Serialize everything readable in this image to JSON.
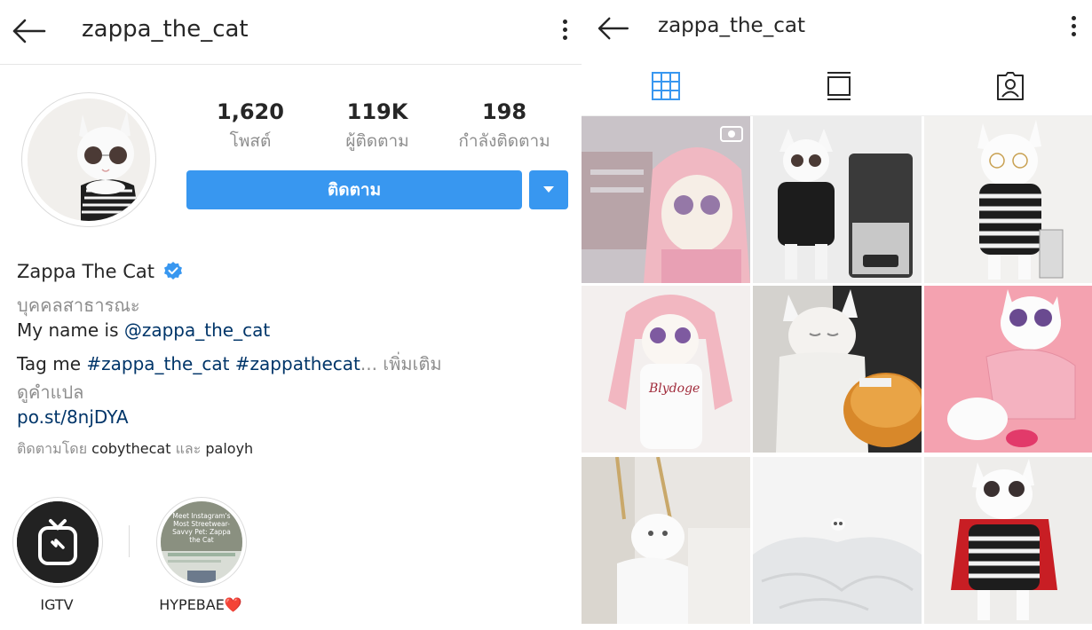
{
  "profile": {
    "username": "zappa_the_cat",
    "stats": [
      {
        "value": "1,620",
        "label": "โพสต์"
      },
      {
        "value": "119K",
        "label": "ผู้ติดตาม"
      },
      {
        "value": "198",
        "label": "กำลังติดตาม"
      }
    ],
    "follow_label": "ติดตาม",
    "display_name": "Zappa The Cat",
    "category": "บุคคลสาธารณะ",
    "bio_line1_prefix": "My name is ",
    "bio_line1_mention": "@zappa_the_cat",
    "bio_line2_prefix": "Tag me ",
    "bio_line2_tags": "#zappa_the_cat #zappathecat",
    "bio_line2_more": "... เพิ่มเติม",
    "translate": "ดูคำแปล",
    "website": "po.st/8njDYA",
    "followed_by_prefix": "ติดตามโดย ",
    "followed_by_user1": "cobythecat",
    "followed_by_and": " และ ",
    "followed_by_user2": "paloyh",
    "highlights": [
      {
        "label": "IGTV"
      },
      {
        "label": "HYPEBAE❤️",
        "thumb_text": "Meet Instagram's Most Streetwear-Savvy Pet: Zappa the Cat"
      }
    ]
  },
  "colors": {
    "primary_button": "#3897f0",
    "active_tab": "#3897f0",
    "link": "#003569",
    "secondary_text": "#8e8e8e"
  },
  "icons": {
    "back": "back-arrow-icon",
    "more": "more-options-icon",
    "dropdown": "chevron-down-icon",
    "verified": "verified-badge-icon",
    "grid_tab": "grid-icon",
    "feed_tab": "feed-icon",
    "tagged_tab": "tagged-icon",
    "video": "video-icon"
  }
}
